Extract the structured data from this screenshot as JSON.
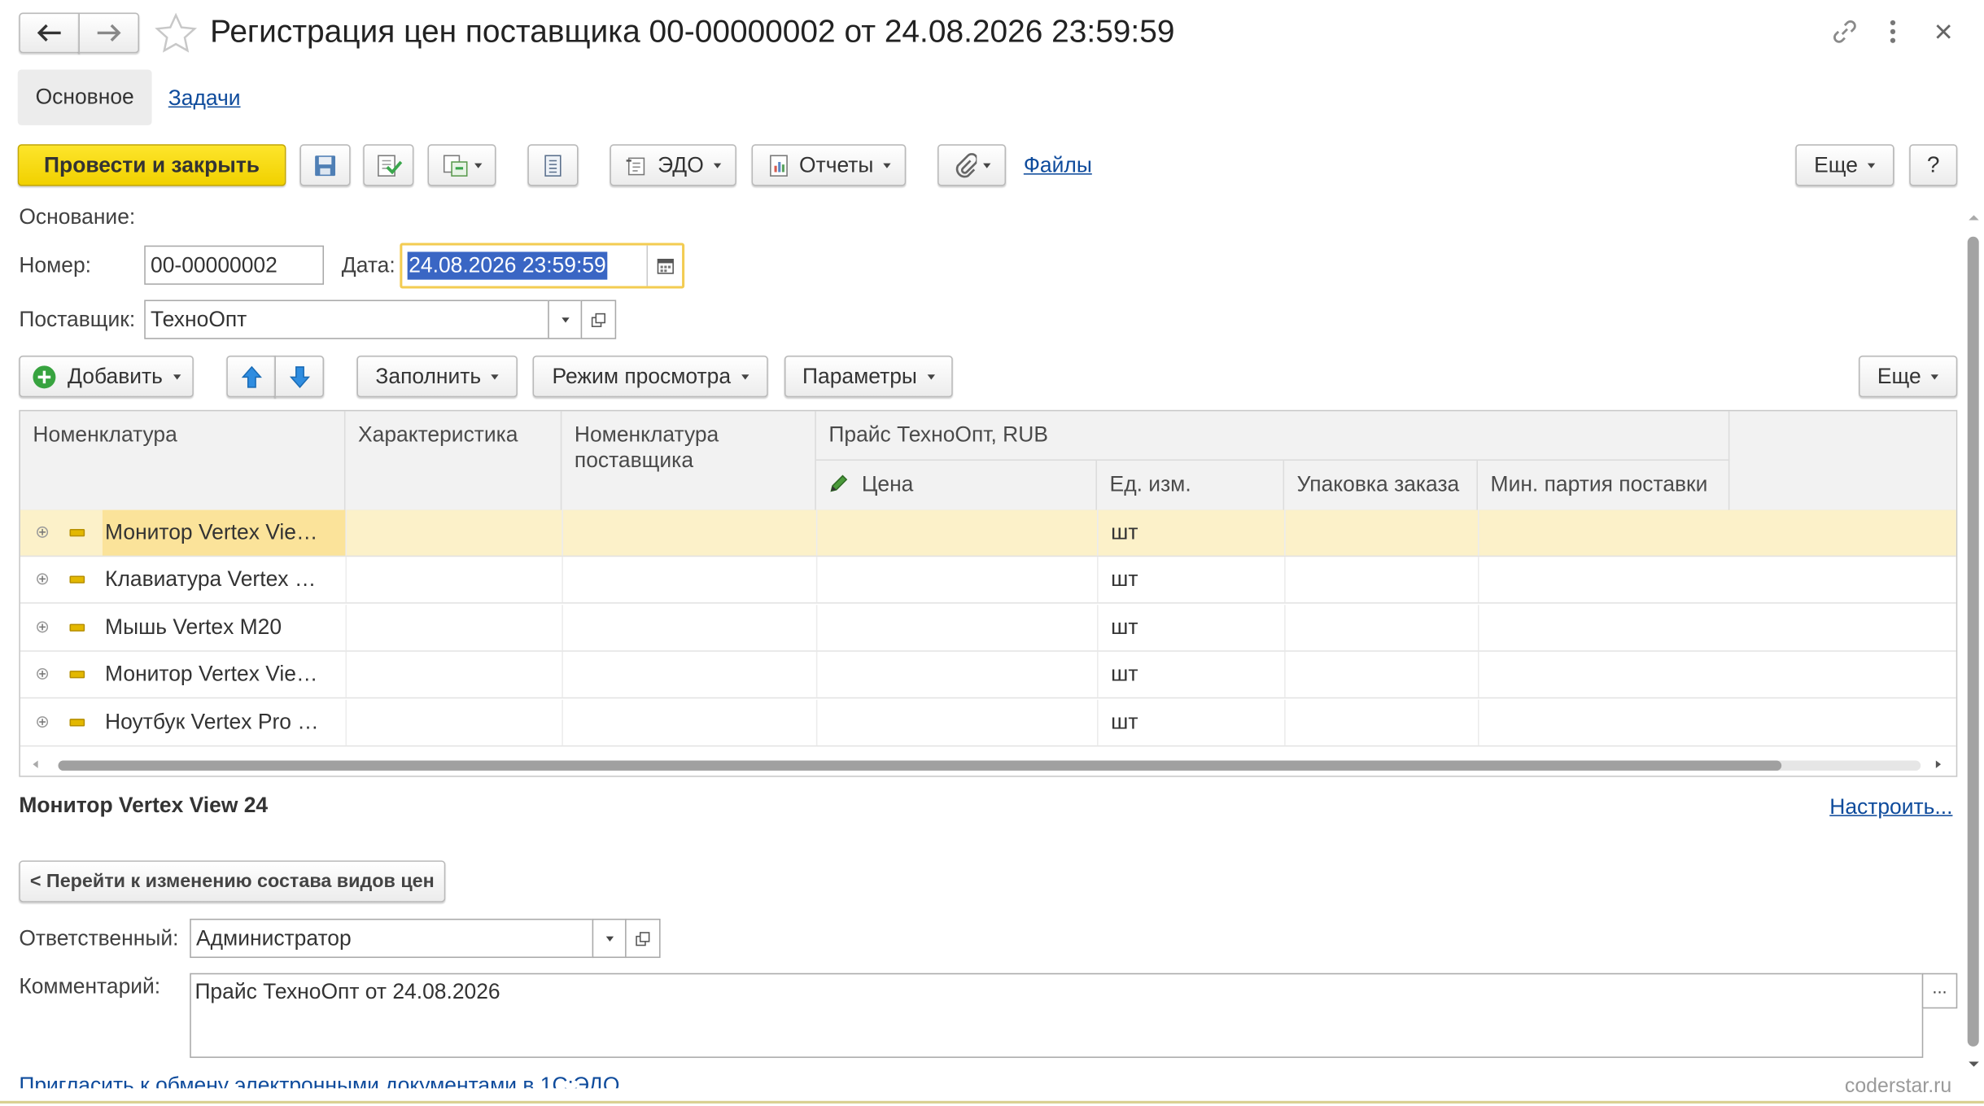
{
  "window": {
    "title": "Регистрация цен поставщика 00-00000002 от 24.08.2026 23:59:59"
  },
  "tabs": [
    {
      "label": "Основное",
      "active": true
    },
    {
      "label": "Задачи",
      "active": false
    }
  ],
  "toolbar": {
    "post_close": "Провести и закрыть",
    "edo": "ЭДО",
    "reports": "Отчеты",
    "files": "Файлы",
    "more": "Еще",
    "help": "?"
  },
  "form": {
    "basis_label": "Основание:",
    "number_label": "Номер:",
    "number_value": "00-00000002",
    "date_label": "Дата:",
    "date_value": "24.08.2026 23:59:59",
    "supplier_label": "Поставщик:",
    "supplier_value": "ТехноОпт"
  },
  "table_toolbar": {
    "add": "Добавить",
    "fill": "Заполнить",
    "view_mode": "Режим просмотра",
    "params": "Параметры",
    "more": "Еще"
  },
  "table": {
    "headers": {
      "nomenclature": "Номенклатура",
      "characteristic": "Характеристика",
      "supplier_nomenclature": "Номенклатура поставщика",
      "price_group": "Прайс ТехноОпт, RUB",
      "price": "Цена",
      "unit": "Ед. изм.",
      "order_pack": "Упаковка заказа",
      "min_batch": "Мин. партия поставки"
    },
    "rows": [
      {
        "name": "Монитор Vertex Vie…",
        "unit": "шт",
        "selected": true
      },
      {
        "name": "Клавиатура Vertex …",
        "unit": "шт",
        "selected": false
      },
      {
        "name": "Мышь Vertex M20",
        "unit": "шт",
        "selected": false
      },
      {
        "name": "Монитор Vertex Vie…",
        "unit": "шт",
        "selected": false
      },
      {
        "name": "Ноутбук Vertex Pro …",
        "unit": "шт",
        "selected": false
      }
    ]
  },
  "details": {
    "selected_item": "Монитор Vertex View 24",
    "configure_link": "Настроить...",
    "goto_price_types": "< Перейти к изменению состава видов цен",
    "responsible_label": "Ответственный:",
    "responsible_value": "Администратор",
    "comment_label": "Комментарий:",
    "comment_value": "Прайс ТехноОпт от 24.08.2026",
    "invite_link": "Пригласить к обмену электронными документами в 1С:ЭДО"
  },
  "watermark": "coderstar.ru",
  "colors": {
    "accent_yellow": "#f5d90a",
    "link_blue": "#0e4b9c",
    "selected_row": "#fcf1c9",
    "date_highlight": "#3a66c4"
  }
}
